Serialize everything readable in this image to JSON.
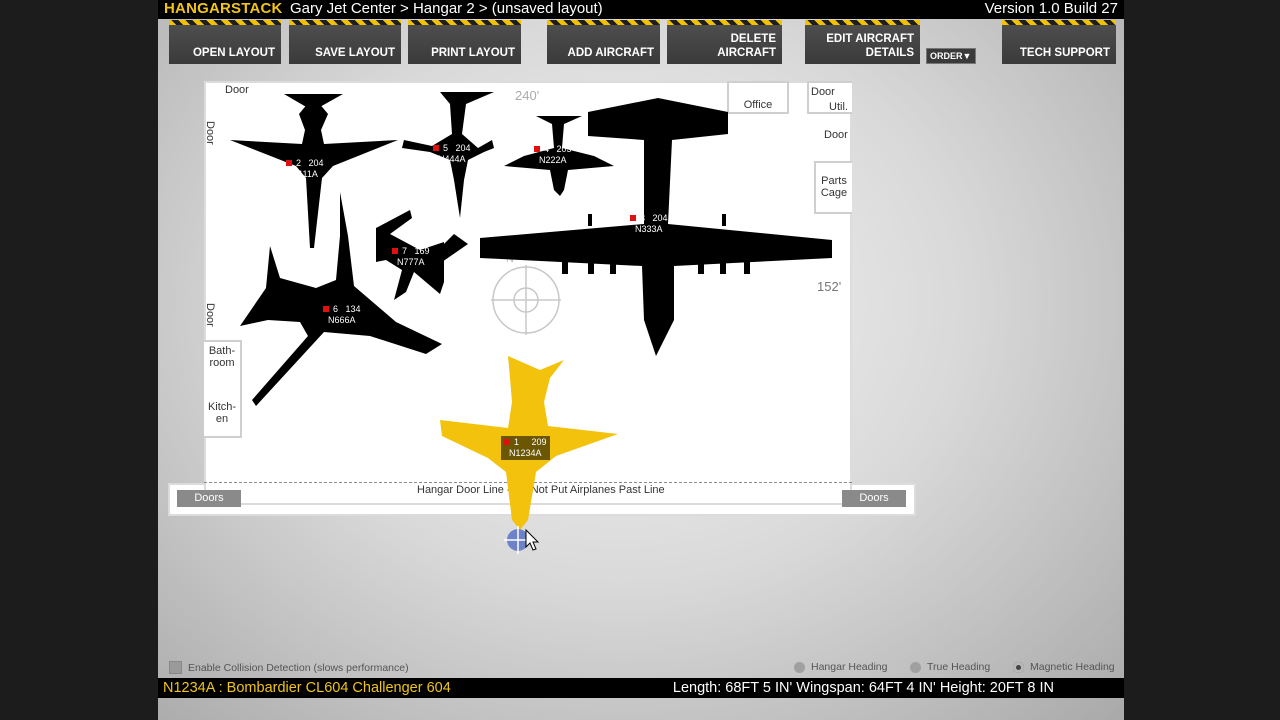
{
  "app": {
    "brand": "HANGARSTACK",
    "breadcrumb": "Gary Jet Center > Hangar 2 > (unsaved layout)",
    "version": "Version 1.0 Build 27"
  },
  "toolbar": {
    "open": "OPEN LAYOUT",
    "save": "SAVE LAYOUT",
    "print": "PRINT LAYOUT",
    "add": "ADD AIRCRAFT",
    "delete_line1": "DELETE",
    "delete_line2": "AIRCRAFT",
    "edit_line1": "EDIT AIRCRAFT",
    "edit_line2": "DETAILS",
    "order": "ORDER",
    "support": "TECH SUPPORT"
  },
  "hangar": {
    "dimension_top": "240'",
    "dimension_right": "152'",
    "door_top_left": "Door",
    "door_left_1": "Door",
    "door_left_2": "Door",
    "door_top_right": "Door",
    "door_right": "Door",
    "office": "Office",
    "util": "Util.",
    "parts_cage_1": "Parts",
    "parts_cage_2": "Cage",
    "bathroom_1": "Bath-",
    "bathroom_2": "room",
    "kitchen_1": "Kitch-",
    "kitchen_2": "en",
    "door_line": "Hangar Door Line - Do Not Put Airplanes Past Line",
    "doors_left": "Doors",
    "doors_right": "Doors"
  },
  "aircraft": [
    {
      "order": "1",
      "heading": "209",
      "tail": "N1234A",
      "color": "#f3c20d"
    },
    {
      "order": "2",
      "heading": "204",
      "tail": "N111A",
      "color": "#000000"
    },
    {
      "order": "3",
      "heading": "204",
      "tail": "N333A",
      "color": "#000000"
    },
    {
      "order": "4",
      "heading": "205",
      "tail": "N222A",
      "color": "#000000"
    },
    {
      "order": "5",
      "heading": "204",
      "tail": "N444A",
      "color": "#000000"
    },
    {
      "order": "6",
      "heading": "134",
      "tail": "N666A",
      "color": "#000000"
    },
    {
      "order": "7",
      "heading": "169",
      "tail": "N777A",
      "color": "#000000"
    }
  ],
  "options": {
    "collision": "Enable Collision Detection (slows performance)",
    "hangar_heading": "Hangar Heading",
    "true_heading": "True Heading",
    "magnetic_heading": "Magnetic Heading"
  },
  "status": {
    "selected": "N1234A : Bombardier CL604 Challenger 604",
    "dimensions": "Length: 68FT 5 IN' Wingspan: 64FT 4 IN' Height: 20FT 8 IN"
  },
  "colors": {
    "accent": "#f0c419",
    "hazard_stripe": "#f2c200",
    "tag_marker": "#e01010"
  }
}
